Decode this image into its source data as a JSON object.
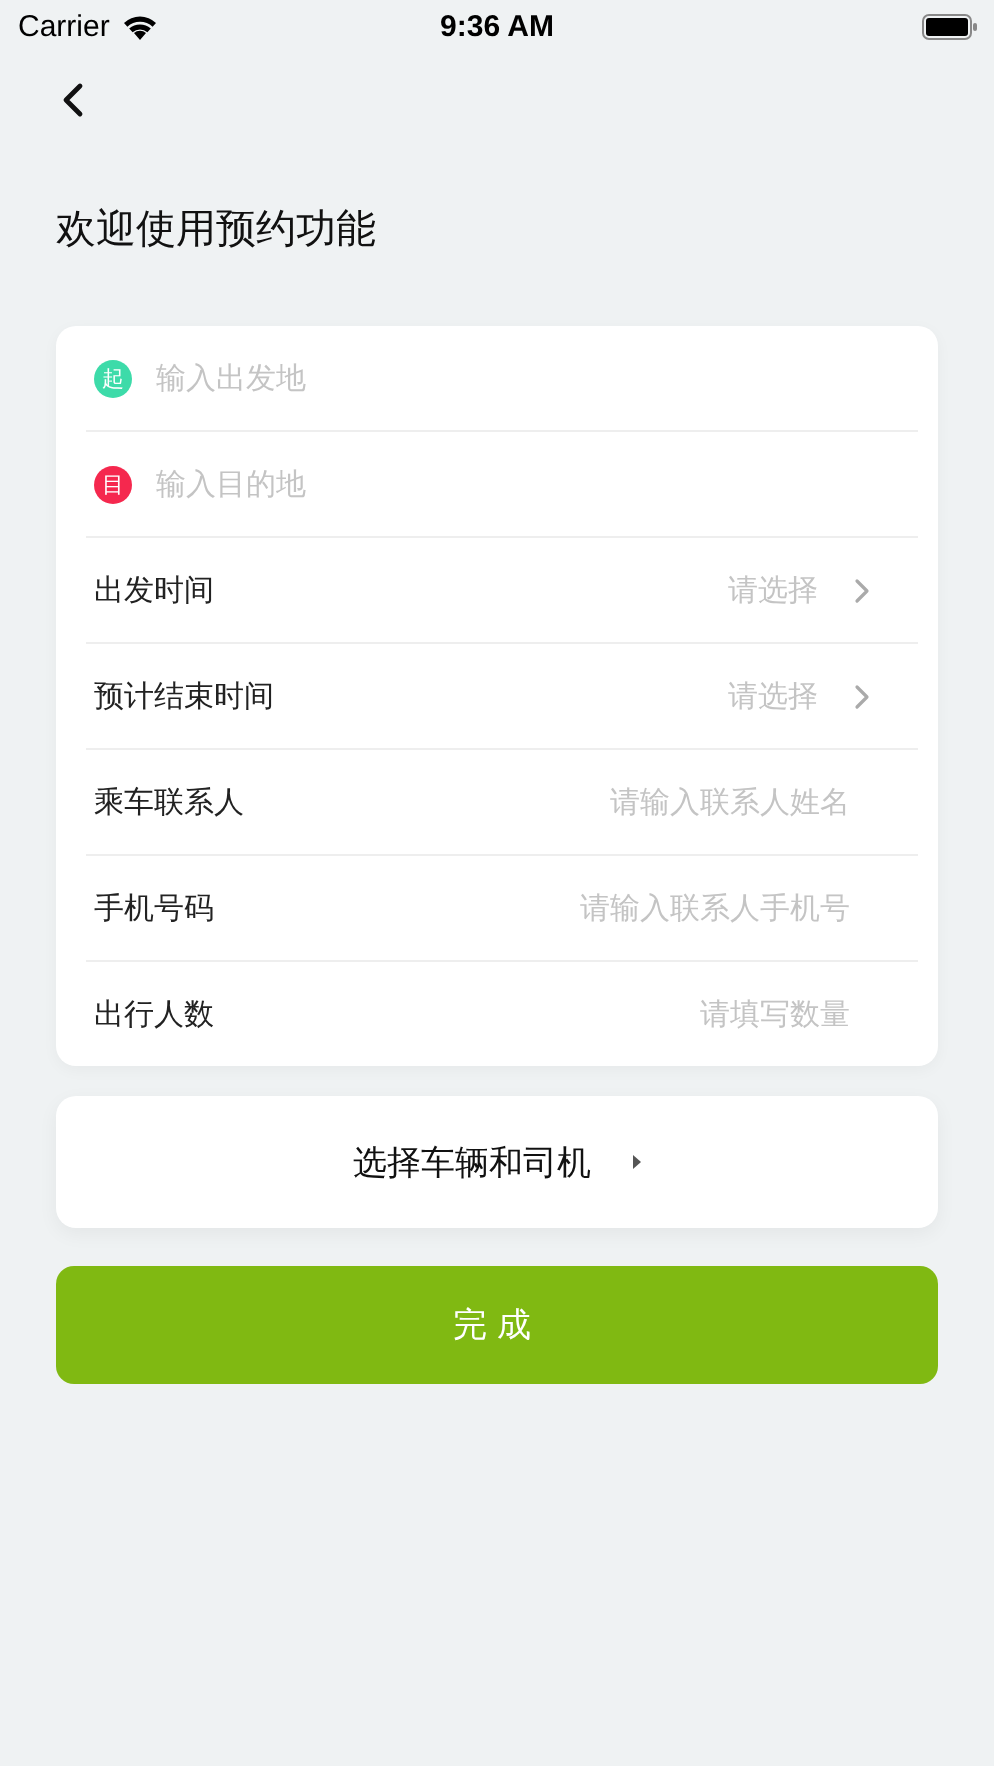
{
  "status_bar": {
    "carrier": "Carrier",
    "time": "9:36 AM"
  },
  "title": "欢迎使用预约功能",
  "form": [
    {
      "kind": "location",
      "badge": "起",
      "color": "#3ddba9",
      "placeholder": "输入出发地"
    },
    {
      "kind": "location",
      "badge": "目",
      "color": "#f5284e",
      "placeholder": "输入目的地"
    },
    {
      "kind": "picker",
      "label": "出发时间",
      "value": "请选择"
    },
    {
      "kind": "picker",
      "label": "预计结束时间",
      "value": "请选择"
    },
    {
      "kind": "input",
      "label": "乘车联系人",
      "placeholder": "请输入联系人姓名"
    },
    {
      "kind": "input",
      "label": "手机号码",
      "placeholder": "请输入联系人手机号"
    },
    {
      "kind": "input",
      "label": "出行人数",
      "placeholder": "请填写数量"
    }
  ],
  "vehicle_button": "选择车辆和司机",
  "submit_button": "完成"
}
